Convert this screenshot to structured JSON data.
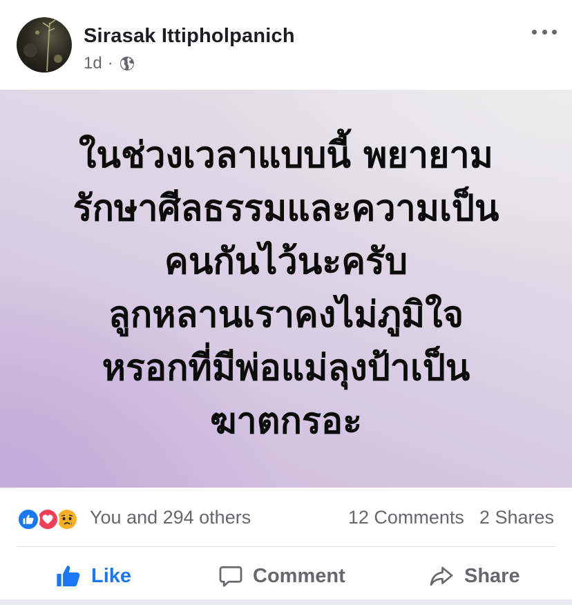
{
  "post": {
    "author": {
      "name": "Sirasak Ittipholpanich",
      "avatar_icon": "profile-photo"
    },
    "meta": {
      "time": "1d",
      "separator": "·",
      "privacy_icon": "globe-icon"
    },
    "more_icon": "more-options-icon",
    "status_background": {
      "colors": [
        "#e6e4e8",
        "#dcd3e4",
        "#c2aad9"
      ]
    },
    "status_lines": [
      "ในช่วงเวลาแบบนี้ พยายาม",
      "รักษาศีลธรรมและความเป็น",
      "คนกันไว้นะครับ",
      "ลูกหลานเราคงไม่ภูมิใจ",
      "หรอกที่มีพ่อแม่ลุงป้าเป็น",
      "ฆาตกรอะ"
    ],
    "stats": {
      "reaction_icons": [
        "like-reaction-icon",
        "love-reaction-icon",
        "sad-reaction-icon"
      ],
      "reactions_text": "You and 294 others",
      "comments": "12 Comments",
      "shares": "2 Shares"
    },
    "actions": {
      "like": "Like",
      "comment": "Comment",
      "share": "Share"
    }
  },
  "colors": {
    "accent": "#1877f2",
    "secondary_text": "#65676b",
    "primary_text": "#1c1e21",
    "love": "#f33e58",
    "sad": "#f7b125"
  }
}
